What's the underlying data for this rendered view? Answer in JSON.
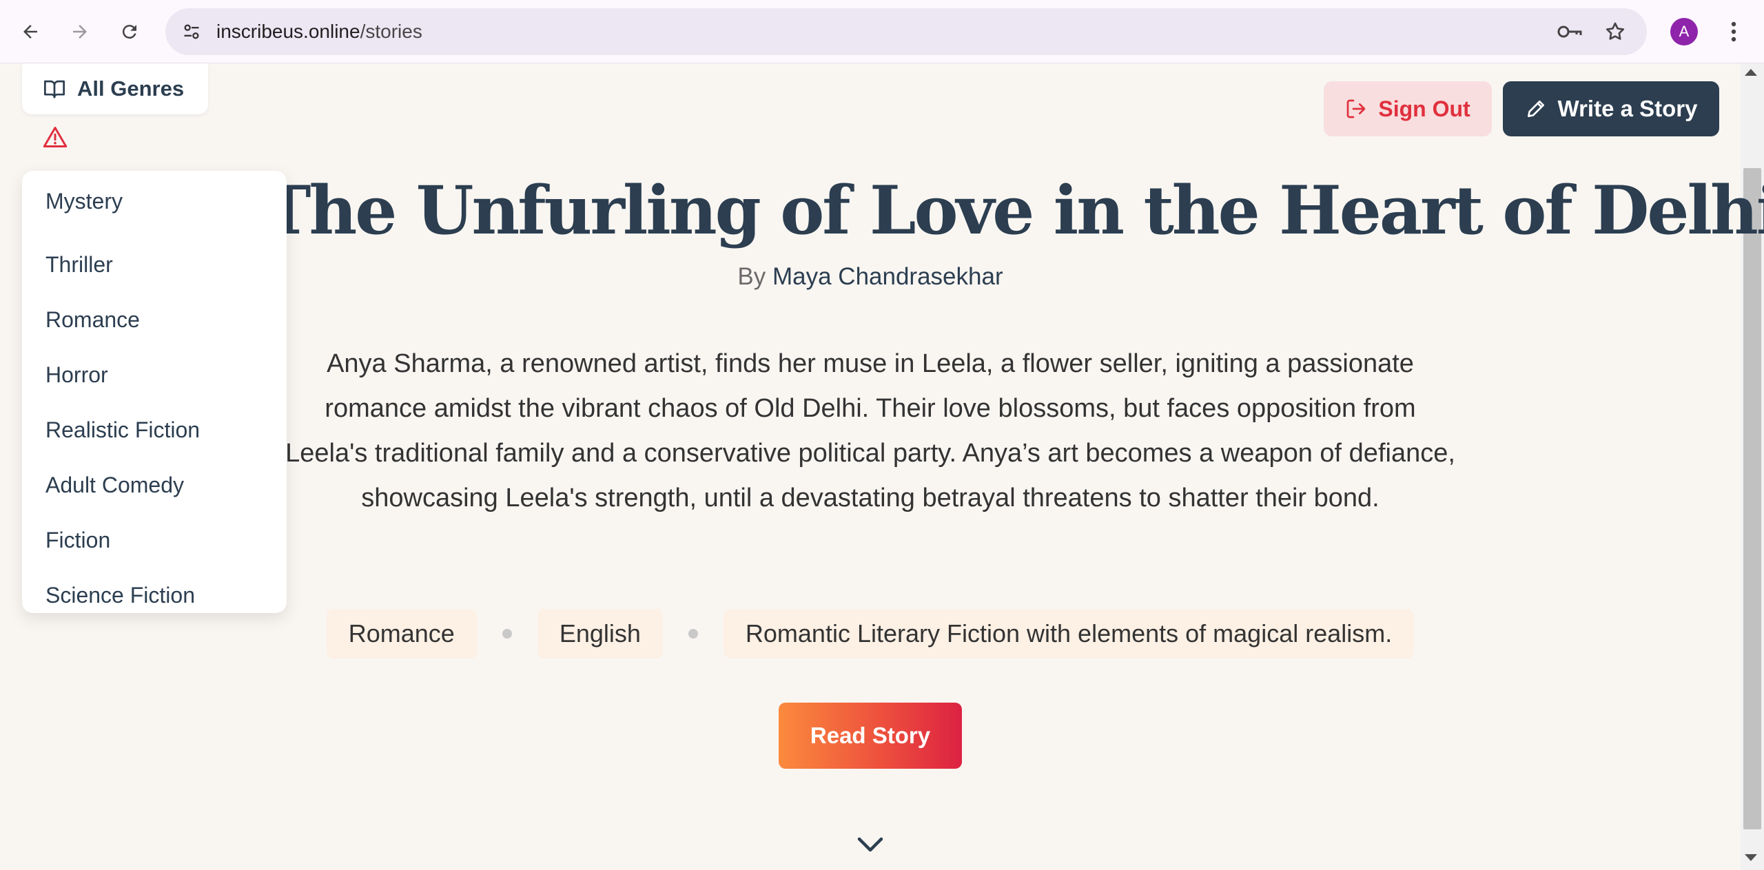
{
  "browser": {
    "url_domain": "inscribeus.online",
    "url_path": "/stories",
    "profile_initial": "A",
    "icons": [
      "back-arrow-icon",
      "forward-arrow-icon",
      "reload-icon",
      "site-settings-icon",
      "password-key-icon",
      "bookmark-star-icon",
      "menu-kebab-icon"
    ]
  },
  "genre_filter": {
    "label": "All Genres",
    "icon": "book-open-icon",
    "warning_icon": "warning-icon",
    "options": [
      "Mystery",
      "Thriller",
      "Romance",
      "Horror",
      "Realistic Fiction",
      "Adult Comedy",
      "Fiction",
      "Science Fiction"
    ]
  },
  "header": {
    "sign_out_label": "Sign Out",
    "write_label": "Write a Story"
  },
  "story": {
    "title": "The Unfurling of Love in the Heart of Delhi",
    "by_prefix": "By",
    "author": "Maya Chandrasekhar",
    "summary": "Anya Sharma, a renowned artist, finds her muse in Leela, a flower seller, igniting a passionate romance amidst the vibrant chaos of Old Delhi. Their love blossoms, but faces opposition from Leela's traditional family and a conservative political party. Anya’s art becomes a weapon of defiance, showcasing Leela's strength, until a devastating betrayal threatens to shatter their bond.",
    "tags": [
      "Romance",
      "English",
      "Romantic Literary Fiction with elements of magical realism."
    ],
    "read_label": "Read Story"
  },
  "colors": {
    "navy": "#2c3e50",
    "sign_out_red": "#e0303e",
    "read_gradient_start": "#fb8a3d",
    "read_gradient_end": "#dc2242",
    "tag_bg": "#fdf0e4",
    "page_bg": "#f9f6f2"
  }
}
